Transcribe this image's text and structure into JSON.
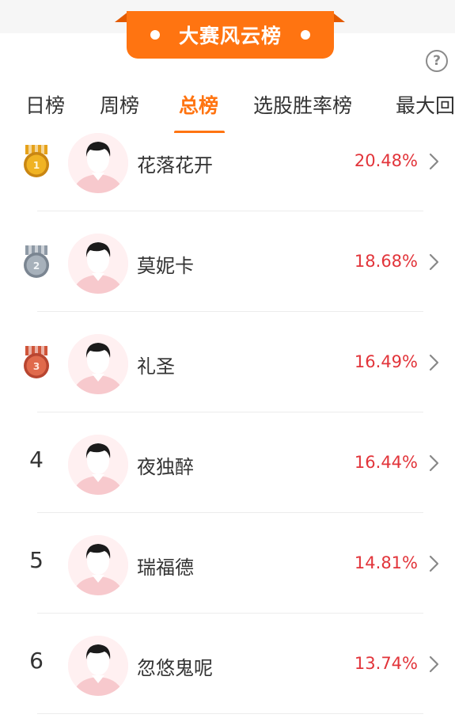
{
  "banner": {
    "title": "大赛风云榜"
  },
  "help": {
    "icon": "question-icon",
    "symbol": "?"
  },
  "tabs": [
    {
      "label": "日榜",
      "active": false
    },
    {
      "label": "周榜",
      "active": false
    },
    {
      "label": "总榜",
      "active": true
    },
    {
      "label": "选股胜率榜",
      "active": false
    },
    {
      "label": "最大回",
      "active": false
    }
  ],
  "rankings": [
    {
      "rank": "1",
      "name": "花落花开",
      "rate": "20.48%",
      "medal": "gold"
    },
    {
      "rank": "2",
      "name": "莫妮卡",
      "rate": "18.68%",
      "medal": "silver"
    },
    {
      "rank": "3",
      "name": "礼圣",
      "rate": "16.49%",
      "medal": "bronze"
    },
    {
      "rank": "4",
      "name": "夜独醉",
      "rate": "16.44%"
    },
    {
      "rank": "5",
      "name": "瑞福德",
      "rate": "14.81%"
    },
    {
      "rank": "6",
      "name": "忽悠鬼呢",
      "rate": "13.74%"
    }
  ],
  "colors": {
    "accent": "#ff7411",
    "rate": "#e2343a",
    "gold": "#e6a21a",
    "silver": "#8f9aa6",
    "bronze": "#d0553a"
  }
}
